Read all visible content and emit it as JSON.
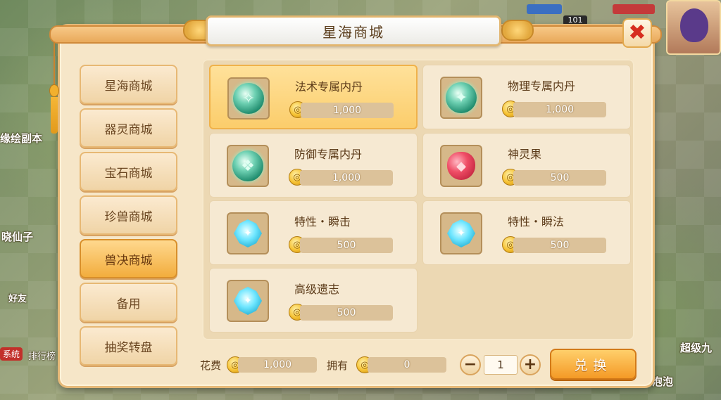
{
  "background": {
    "left_texts": [
      "缘绘副本",
      "晓仙子",
      "好友",
      "排行榜",
      "系统"
    ],
    "right_texts": [
      "超级九",
      "泡泡"
    ],
    "top_number": "101"
  },
  "window": {
    "title": "星海商城",
    "close_glyph": "✖"
  },
  "tabs": [
    {
      "label": "星海商城",
      "active": false
    },
    {
      "label": "器灵商城",
      "active": false
    },
    {
      "label": "宝石商城",
      "active": false
    },
    {
      "label": "珍兽商城",
      "active": false
    },
    {
      "label": "兽决商城",
      "active": true
    },
    {
      "label": "备用",
      "active": false
    },
    {
      "label": "抽奖转盘",
      "active": false
    }
  ],
  "items": [
    {
      "name": "法术专属内丹",
      "price": "1,000",
      "icon": "spell-pill-icon",
      "selected": true
    },
    {
      "name": "物理专属内丹",
      "price": "1,000",
      "icon": "physical-pill-icon",
      "selected": false
    },
    {
      "name": "防御专属内丹",
      "price": "1,000",
      "icon": "defense-pill-icon",
      "selected": false
    },
    {
      "name": "神灵果",
      "price": "500",
      "icon": "divine-fruit-icon",
      "selected": false
    },
    {
      "name": "特性・瞬击",
      "price": "500",
      "icon": "skill-book-icon",
      "selected": false
    },
    {
      "name": "特性・瞬法",
      "price": "500",
      "icon": "skill-book-icon",
      "selected": false
    },
    {
      "name": "高级遗志",
      "price": "500",
      "icon": "skill-book-icon",
      "selected": false
    }
  ],
  "footer": {
    "cost_label": "花费",
    "cost_value": "1,000",
    "owned_label": "拥有",
    "owned_value": "0",
    "quantity": "1",
    "minus": "−",
    "plus": "+",
    "exchange_label": "兑换"
  },
  "colors": {
    "accent": "#f49a26",
    "close": "#d62d1f",
    "selected_card": "#fbcd6b"
  }
}
